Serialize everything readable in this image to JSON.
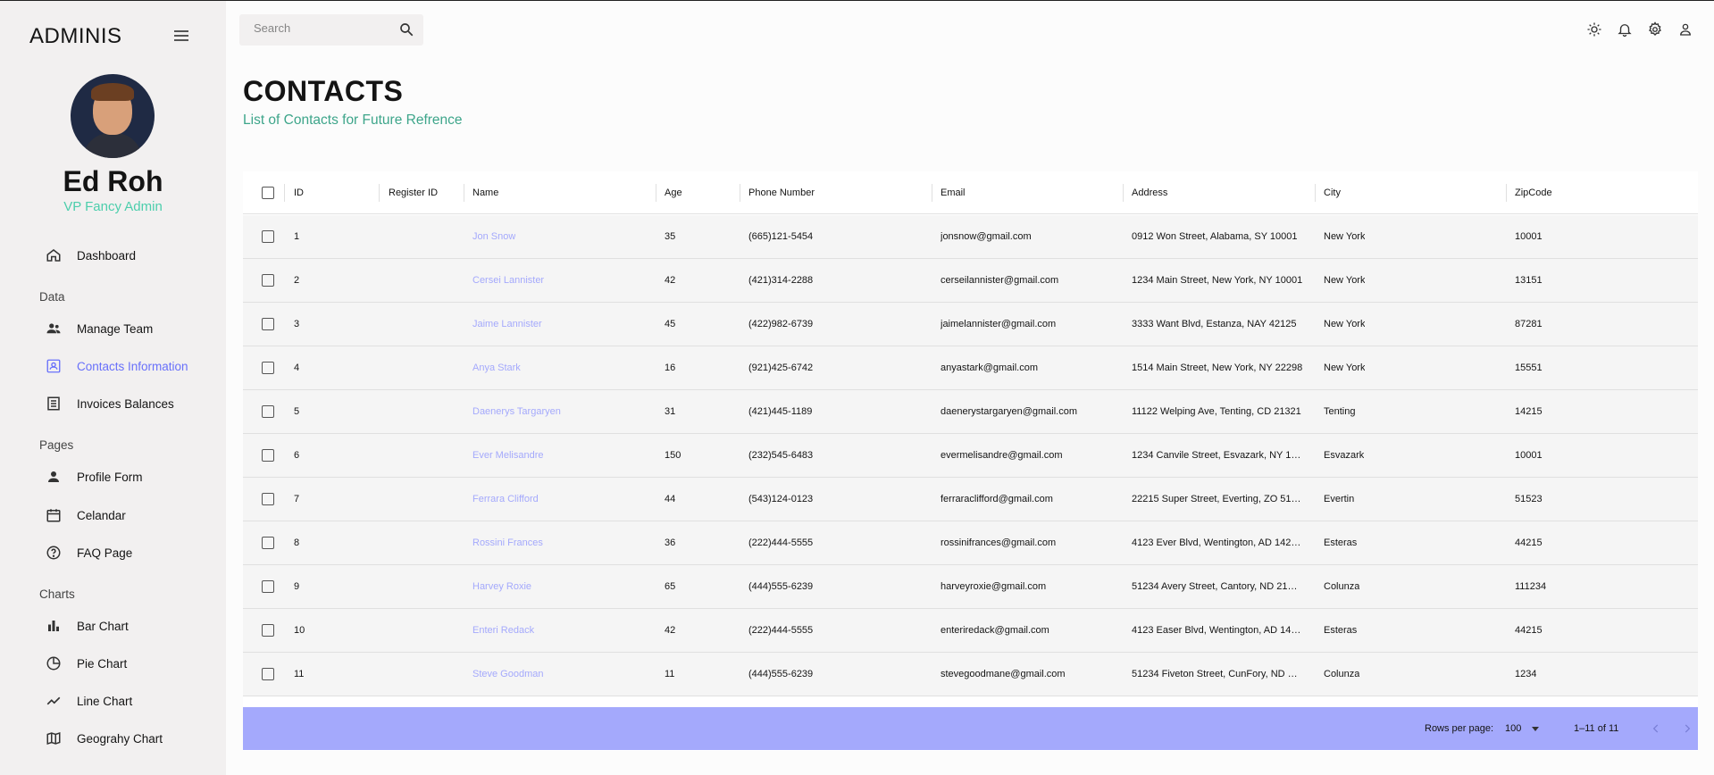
{
  "sidebar": {
    "brand": "ADMINIS",
    "user_name": "Ed Roh",
    "user_role": "VP Fancy Admin",
    "dashboard": "Dashboard",
    "section_data": "Data",
    "manage_team": "Manage Team",
    "contacts": "Contacts Information",
    "invoices": "Invoices Balances",
    "section_pages": "Pages",
    "profile_form": "Profile Form",
    "calendar": "Celandar",
    "faq": "FAQ Page",
    "section_charts": "Charts",
    "bar_chart": "Bar Chart",
    "pie_chart": "Pie Chart",
    "line_chart": "Line Chart",
    "geography_chart": "Geograhy Chart"
  },
  "topbar": {
    "search_placeholder": "Search",
    "icons": [
      "light-mode-icon",
      "notifications-icon",
      "settings-icon",
      "person-icon"
    ]
  },
  "header": {
    "title": "CONTACTS",
    "subtitle": "List of Contacts for Future Refrence"
  },
  "colors": {
    "accent_green": "#4cceac",
    "accent_blue": "#6870fa",
    "name_link": "#a4a9fc",
    "footer_bg": "#a4a9fc"
  },
  "table": {
    "headers": [
      "ID",
      "Register ID",
      "Name",
      "Age",
      "Phone Number",
      "Email",
      "Address",
      "City",
      "ZipCode"
    ],
    "rows": [
      {
        "id": "1",
        "register_id": "",
        "name": "Jon Snow",
        "age": "35",
        "phone": "(665)121-5454",
        "email": "jonsnow@gmail.com",
        "address": "0912 Won Street, Alabama, SY 10001",
        "city": "New York",
        "zip": "10001"
      },
      {
        "id": "2",
        "register_id": "",
        "name": "Cersei Lannister",
        "age": "42",
        "phone": "(421)314-2288",
        "email": "cerseilannister@gmail.com",
        "address": "1234 Main Street, New York, NY 10001",
        "city": "New York",
        "zip": "13151"
      },
      {
        "id": "3",
        "register_id": "",
        "name": "Jaime Lannister",
        "age": "45",
        "phone": "(422)982-6739",
        "email": "jaimelannister@gmail.com",
        "address": "3333 Want Blvd, Estanza, NAY 42125",
        "city": "New York",
        "zip": "87281"
      },
      {
        "id": "4",
        "register_id": "",
        "name": "Anya Stark",
        "age": "16",
        "phone": "(921)425-6742",
        "email": "anyastark@gmail.com",
        "address": "1514 Main Street, New York, NY 22298",
        "city": "New York",
        "zip": "15551"
      },
      {
        "id": "5",
        "register_id": "",
        "name": "Daenerys Targaryen",
        "age": "31",
        "phone": "(421)445-1189",
        "email": "daenerystargaryen@gmail.com",
        "address": "11122 Welping Ave, Tenting, CD 21321",
        "city": "Tenting",
        "zip": "14215"
      },
      {
        "id": "6",
        "register_id": "",
        "name": "Ever Melisandre",
        "age": "150",
        "phone": "(232)545-6483",
        "email": "evermelisandre@gmail.com",
        "address": "1234 Canvile Street, Esvazark, NY 1…",
        "city": "Esvazark",
        "zip": "10001"
      },
      {
        "id": "7",
        "register_id": "",
        "name": "Ferrara Clifford",
        "age": "44",
        "phone": "(543)124-0123",
        "email": "ferraraclifford@gmail.com",
        "address": "22215 Super Street, Everting, ZO 51…",
        "city": "Evertin",
        "zip": "51523"
      },
      {
        "id": "8",
        "register_id": "",
        "name": "Rossini Frances",
        "age": "36",
        "phone": "(222)444-5555",
        "email": "rossinifrances@gmail.com",
        "address": "4123 Ever Blvd, Wentington, AD 142…",
        "city": "Esteras",
        "zip": "44215"
      },
      {
        "id": "9",
        "register_id": "",
        "name": "Harvey Roxie",
        "age": "65",
        "phone": "(444)555-6239",
        "email": "harveyroxie@gmail.com",
        "address": "51234 Avery Street, Cantory, ND 21…",
        "city": "Colunza",
        "zip": "111234"
      },
      {
        "id": "10",
        "register_id": "",
        "name": "Enteri Redack",
        "age": "42",
        "phone": "(222)444-5555",
        "email": "enteriredack@gmail.com",
        "address": "4123 Easer Blvd, Wentington, AD 14…",
        "city": "Esteras",
        "zip": "44215"
      },
      {
        "id": "11",
        "register_id": "",
        "name": "Steve Goodman",
        "age": "11",
        "phone": "(444)555-6239",
        "email": "stevegoodmane@gmail.com",
        "address": "51234 Fiveton Street, CunFory, ND …",
        "city": "Colunza",
        "zip": "1234"
      }
    ]
  },
  "footer": {
    "rows_per_page_label": "Rows per page:",
    "rows_per_page_value": "100",
    "range": "1–11 of 11"
  }
}
